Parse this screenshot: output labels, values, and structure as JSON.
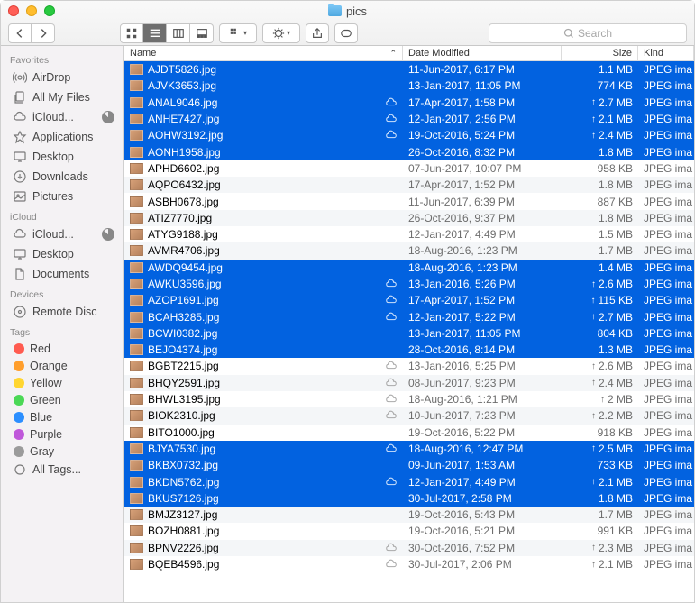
{
  "window": {
    "title": "pics"
  },
  "search": {
    "placeholder": "Search"
  },
  "columns": {
    "name": "Name",
    "date": "Date Modified",
    "size": "Size",
    "kind": "Kind"
  },
  "sidebar": {
    "sections": [
      {
        "label": "Favorites",
        "items": [
          {
            "icon": "airdrop",
            "label": "AirDrop"
          },
          {
            "icon": "allfiles",
            "label": "All My Files"
          },
          {
            "icon": "icloud",
            "label": "iCloud...",
            "pie": true
          },
          {
            "icon": "apps",
            "label": "Applications"
          },
          {
            "icon": "desktop",
            "label": "Desktop"
          },
          {
            "icon": "downloads",
            "label": "Downloads"
          },
          {
            "icon": "pictures",
            "label": "Pictures"
          }
        ]
      },
      {
        "label": "iCloud",
        "items": [
          {
            "icon": "icloud",
            "label": "iCloud...",
            "pie": true
          },
          {
            "icon": "desktop",
            "label": "Desktop"
          },
          {
            "icon": "documents",
            "label": "Documents"
          }
        ]
      },
      {
        "label": "Devices",
        "items": [
          {
            "icon": "disc",
            "label": "Remote Disc"
          }
        ]
      },
      {
        "label": "Tags",
        "items": [
          {
            "tag": "#ff5b50",
            "label": "Red"
          },
          {
            "tag": "#ff9e2c",
            "label": "Orange"
          },
          {
            "tag": "#ffd631",
            "label": "Yellow"
          },
          {
            "tag": "#4bd856",
            "label": "Green"
          },
          {
            "tag": "#2c8fff",
            "label": "Blue"
          },
          {
            "tag": "#bf58da",
            "label": "Purple"
          },
          {
            "tag": "#9b9b9b",
            "label": "Gray"
          },
          {
            "icon": "alltags",
            "label": "All Tags..."
          }
        ]
      }
    ]
  },
  "files": [
    {
      "name": "AJDT5826.jpg",
      "date": "11-Jun-2017, 6:17 PM",
      "size": "1.1 MB",
      "kind": "JPEG ima",
      "sel": true
    },
    {
      "name": "AJVK3653.jpg",
      "date": "13-Jan-2017, 11:05 PM",
      "size": "774 KB",
      "kind": "JPEG ima",
      "sel": true
    },
    {
      "name": "ANAL9046.jpg",
      "date": "17-Apr-2017, 1:58 PM",
      "size": "2.7 MB",
      "kind": "JPEG ima",
      "sel": true,
      "cloud": true,
      "up": true
    },
    {
      "name": "ANHE7427.jpg",
      "date": "12-Jan-2017, 2:56 PM",
      "size": "2.1 MB",
      "kind": "JPEG ima",
      "sel": true,
      "cloud": true,
      "up": true
    },
    {
      "name": "AOHW3192.jpg",
      "date": "19-Oct-2016, 5:24 PM",
      "size": "2.4 MB",
      "kind": "JPEG ima",
      "sel": true,
      "cloud": true,
      "up": true
    },
    {
      "name": "AONH1958.jpg",
      "date": "26-Oct-2016, 8:32 PM",
      "size": "1.8 MB",
      "kind": "JPEG ima",
      "sel": true
    },
    {
      "name": "APHD6602.jpg",
      "date": "07-Jun-2017, 10:07 PM",
      "size": "958 KB",
      "kind": "JPEG ima"
    },
    {
      "name": "AQPO6432.jpg",
      "date": "17-Apr-2017, 1:52 PM",
      "size": "1.8 MB",
      "kind": "JPEG ima"
    },
    {
      "name": "ASBH0678.jpg",
      "date": "11-Jun-2017, 6:39 PM",
      "size": "887 KB",
      "kind": "JPEG ima"
    },
    {
      "name": "ATIZ7770.jpg",
      "date": "26-Oct-2016, 9:37 PM",
      "size": "1.8 MB",
      "kind": "JPEG ima"
    },
    {
      "name": "ATYG9188.jpg",
      "date": "12-Jan-2017, 4:49 PM",
      "size": "1.5 MB",
      "kind": "JPEG ima"
    },
    {
      "name": "AVMR4706.jpg",
      "date": "18-Aug-2016, 1:23 PM",
      "size": "1.7 MB",
      "kind": "JPEG ima"
    },
    {
      "name": "AWDQ9454.jpg",
      "date": "18-Aug-2016, 1:23 PM",
      "size": "1.4 MB",
      "kind": "JPEG ima",
      "sel": true
    },
    {
      "name": "AWKU3596.jpg",
      "date": "13-Jan-2016, 5:26 PM",
      "size": "2.6 MB",
      "kind": "JPEG ima",
      "sel": true,
      "cloud": true,
      "up": true
    },
    {
      "name": "AZOP1691.jpg",
      "date": "17-Apr-2017, 1:52 PM",
      "size": "115 KB",
      "kind": "JPEG ima",
      "sel": true,
      "cloud": true,
      "up": true
    },
    {
      "name": "BCAH3285.jpg",
      "date": "12-Jan-2017, 5:22 PM",
      "size": "2.7 MB",
      "kind": "JPEG ima",
      "sel": true,
      "cloud": true,
      "up": true
    },
    {
      "name": "BCWI0382.jpg",
      "date": "13-Jan-2017, 11:05 PM",
      "size": "804 KB",
      "kind": "JPEG ima",
      "sel": true
    },
    {
      "name": "BEJO4374.jpg",
      "date": "28-Oct-2016, 8:14 PM",
      "size": "1.3 MB",
      "kind": "JPEG ima",
      "sel": true
    },
    {
      "name": "BGBT2215.jpg",
      "date": "13-Jan-2016, 5:25 PM",
      "size": "2.6 MB",
      "kind": "JPEG ima",
      "cloud": true,
      "up": true
    },
    {
      "name": "BHQY2591.jpg",
      "date": "08-Jun-2017, 9:23 PM",
      "size": "2.4 MB",
      "kind": "JPEG ima",
      "cloud": true,
      "up": true
    },
    {
      "name": "BHWL3195.jpg",
      "date": "18-Aug-2016, 1:21 PM",
      "size": "2 MB",
      "kind": "JPEG ima",
      "cloud": true,
      "up": true
    },
    {
      "name": "BIOK2310.jpg",
      "date": "10-Jun-2017, 7:23 PM",
      "size": "2.2 MB",
      "kind": "JPEG ima",
      "cloud": true,
      "up": true
    },
    {
      "name": "BITO1000.jpg",
      "date": "19-Oct-2016, 5:22 PM",
      "size": "918 KB",
      "kind": "JPEG ima"
    },
    {
      "name": "BJYA7530.jpg",
      "date": "18-Aug-2016, 12:47 PM",
      "size": "2.5 MB",
      "kind": "JPEG ima",
      "sel": true,
      "cloud": true,
      "up": true
    },
    {
      "name": "BKBX0732.jpg",
      "date": "09-Jun-2017, 1:53 AM",
      "size": "733 KB",
      "kind": "JPEG ima",
      "sel": true
    },
    {
      "name": "BKDN5762.jpg",
      "date": "12-Jan-2017, 4:49 PM",
      "size": "2.1 MB",
      "kind": "JPEG ima",
      "sel": true,
      "cloud": true,
      "up": true
    },
    {
      "name": "BKUS7126.jpg",
      "date": "30-Jul-2017, 2:58 PM",
      "size": "1.8 MB",
      "kind": "JPEG ima",
      "sel": true
    },
    {
      "name": "BMJZ3127.jpg",
      "date": "19-Oct-2016, 5:43 PM",
      "size": "1.7 MB",
      "kind": "JPEG ima"
    },
    {
      "name": "BOZH0881.jpg",
      "date": "19-Oct-2016, 5:21 PM",
      "size": "991 KB",
      "kind": "JPEG ima"
    },
    {
      "name": "BPNV2226.jpg",
      "date": "30-Oct-2016, 7:52 PM",
      "size": "2.3 MB",
      "kind": "JPEG ima",
      "cloud": true,
      "up": true
    },
    {
      "name": "BQEB4596.jpg",
      "date": "30-Jul-2017, 2:06 PM",
      "size": "2.1 MB",
      "kind": "JPEG ima",
      "cloud": true,
      "up": true
    }
  ]
}
